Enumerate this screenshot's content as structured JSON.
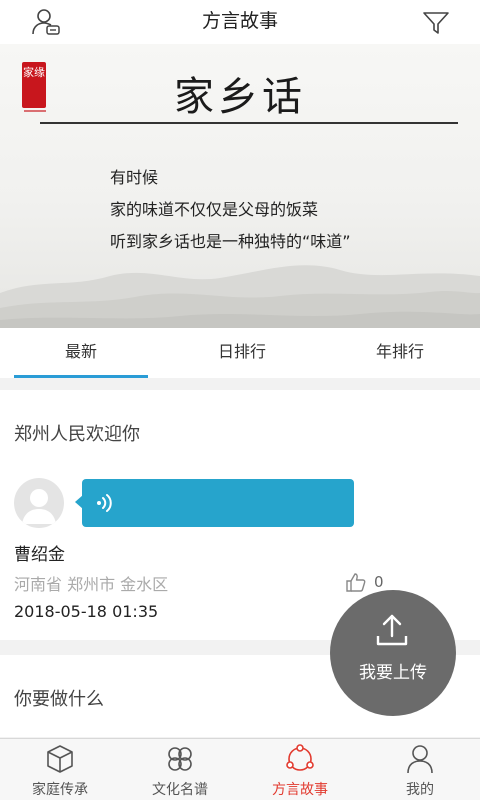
{
  "navbar": {
    "title": "方言故事",
    "left_icon": "user-chat-icon",
    "right_icon": "filter-icon"
  },
  "banner": {
    "seal_text": "家缘",
    "title": "家乡话",
    "lines": [
      "有时候",
      "家的味道不仅仅是父母的饭菜",
      "听到家乡话也是一种独特的“味道”"
    ]
  },
  "tabs": [
    {
      "label": "最新",
      "active": true
    },
    {
      "label": "日排行",
      "active": false
    },
    {
      "label": "年排行",
      "active": false
    }
  ],
  "posts": [
    {
      "title": "郑州人民欢迎你",
      "author": "曹绍金",
      "location": "河南省 郑州市 金水区",
      "likes": "0",
      "datetime": "2018-05-18 01:35"
    },
    {
      "title": "你要做什么"
    }
  ],
  "upload": {
    "label": "我要上传",
    "icon": "upload-icon"
  },
  "tabbar": [
    {
      "label": "家庭传承",
      "icon": "cube-icon",
      "active": false
    },
    {
      "label": "文化名谱",
      "icon": "clover-icon",
      "active": false
    },
    {
      "label": "方言故事",
      "icon": "share-nodes-icon",
      "active": true
    },
    {
      "label": "我的",
      "icon": "person-icon",
      "active": false
    }
  ],
  "colors": {
    "accent": "#2a9cd6",
    "voice_bubble": "#26a4cc",
    "active_tab": "#e23a2f",
    "seal_red": "#c8161d"
  }
}
